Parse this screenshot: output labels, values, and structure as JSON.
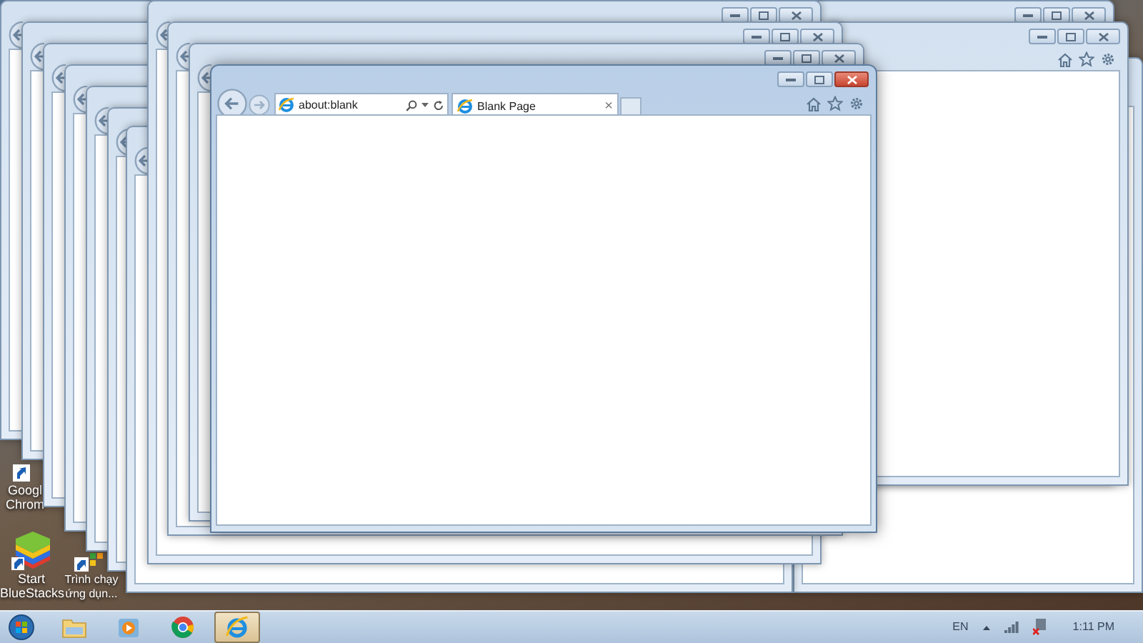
{
  "desktop_icons": [
    {
      "kind": "chrome",
      "label": "Googl Chrom"
    },
    {
      "kind": "bluestacks",
      "label": "Start BlueStacks"
    },
    {
      "kind": "launcher",
      "label": "Trình chạy ứng dụn..."
    }
  ],
  "browser": {
    "address": "about:blank",
    "tab": {
      "title": "Blank Page",
      "close": "×",
      "selected": true
    }
  },
  "taskbar": {
    "items": [
      {
        "kind": "explorer",
        "selected": false
      },
      {
        "kind": "media",
        "selected": false
      },
      {
        "kind": "chrome",
        "selected": false
      },
      {
        "kind": "ie",
        "selected": true
      }
    ],
    "language": "EN",
    "clock": "1:11 PM"
  }
}
